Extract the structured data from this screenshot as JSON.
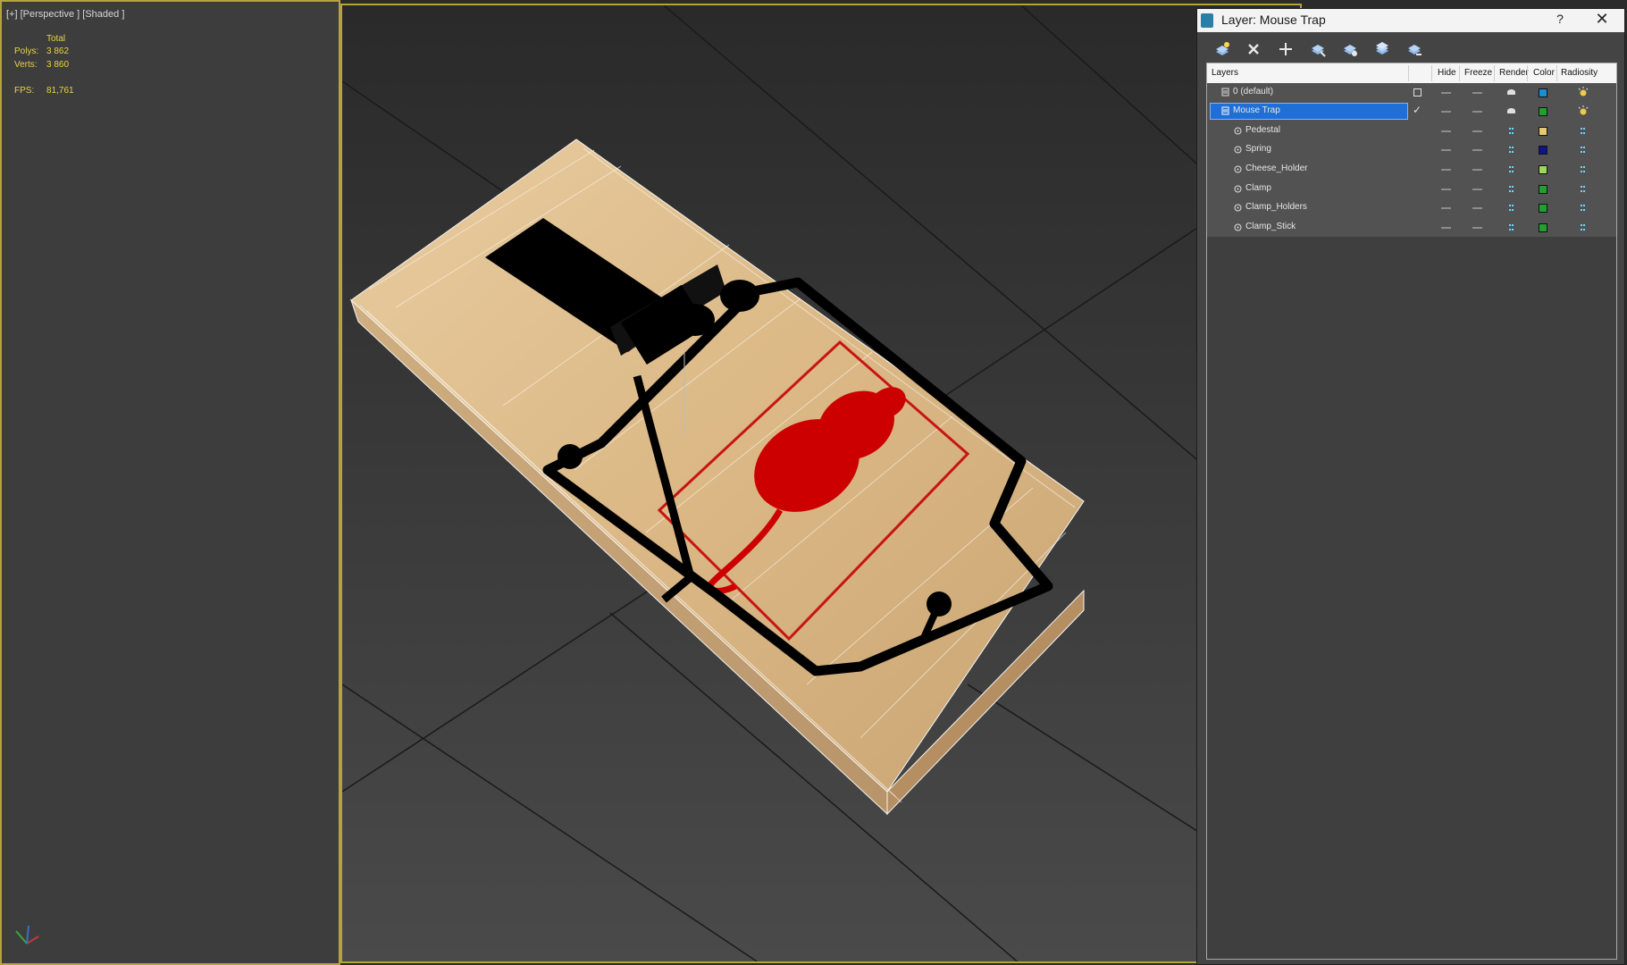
{
  "viewport": {
    "label": "[+] [Perspective ] [Shaded ]",
    "stats": {
      "total_label": "Total",
      "polys_label": "Polys:",
      "polys_value": "3 862",
      "verts_label": "Verts:",
      "verts_value": "3 860",
      "fps_label": "FPS:",
      "fps_value": "81,761"
    }
  },
  "layer_panel": {
    "title": "Layer: Mouse Trap",
    "help": "?",
    "close": "✕",
    "toolbar": [
      {
        "icon": "create-layer-icon"
      },
      {
        "icon": "delete-layer-icon"
      },
      {
        "icon": "add-to-layer-icon"
      },
      {
        "icon": "select-objects-icon"
      },
      {
        "icon": "select-layer-icon"
      },
      {
        "icon": "hide-all-icon"
      },
      {
        "icon": "freeze-all-icon"
      }
    ],
    "columns": [
      "Layers",
      "Hide",
      "Freeze",
      "Render",
      "Color",
      "Radiosity"
    ],
    "rows": [
      {
        "name": "0 (default)",
        "kind": "layer",
        "color": "#1b8fd6",
        "current": "box",
        "radiosity": "sun",
        "render": "teapot"
      },
      {
        "name": "Mouse Trap",
        "kind": "layer",
        "color": "#1fa02f",
        "current": "check",
        "radiosity": "sun",
        "render": "teapot",
        "selected": true
      },
      {
        "name": "Pedestal",
        "kind": "object",
        "color": "#e5c96e"
      },
      {
        "name": "Spring",
        "kind": "object",
        "color": "#12138a"
      },
      {
        "name": "Cheese_Holder",
        "kind": "object",
        "color": "#9bd85a"
      },
      {
        "name": "Clamp",
        "kind": "object",
        "color": "#1fa02f"
      },
      {
        "name": "Clamp_Holders",
        "kind": "object",
        "color": "#1fa02f"
      },
      {
        "name": "Clamp_Stick",
        "kind": "object",
        "color": "#1fa02f"
      }
    ]
  }
}
